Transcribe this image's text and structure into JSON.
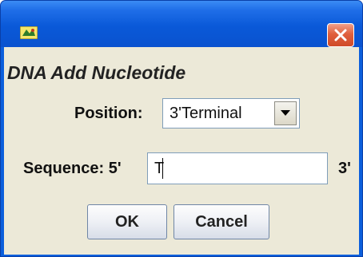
{
  "window": {
    "title": "",
    "icon": "java-app-icon",
    "close_icon": "close-icon"
  },
  "dialog": {
    "heading": "DNA Add Nucleotide",
    "position_label": "Position:",
    "position_value": "3'Terminal",
    "sequence_label": "Sequence: 5'",
    "sequence_value": "T",
    "sequence_suffix": "3'",
    "ok_label": "OK",
    "cancel_label": "Cancel"
  },
  "colors": {
    "titlebar": "#0a59d8",
    "close_button": "#e0603d",
    "client_background": "#ece9d8"
  }
}
